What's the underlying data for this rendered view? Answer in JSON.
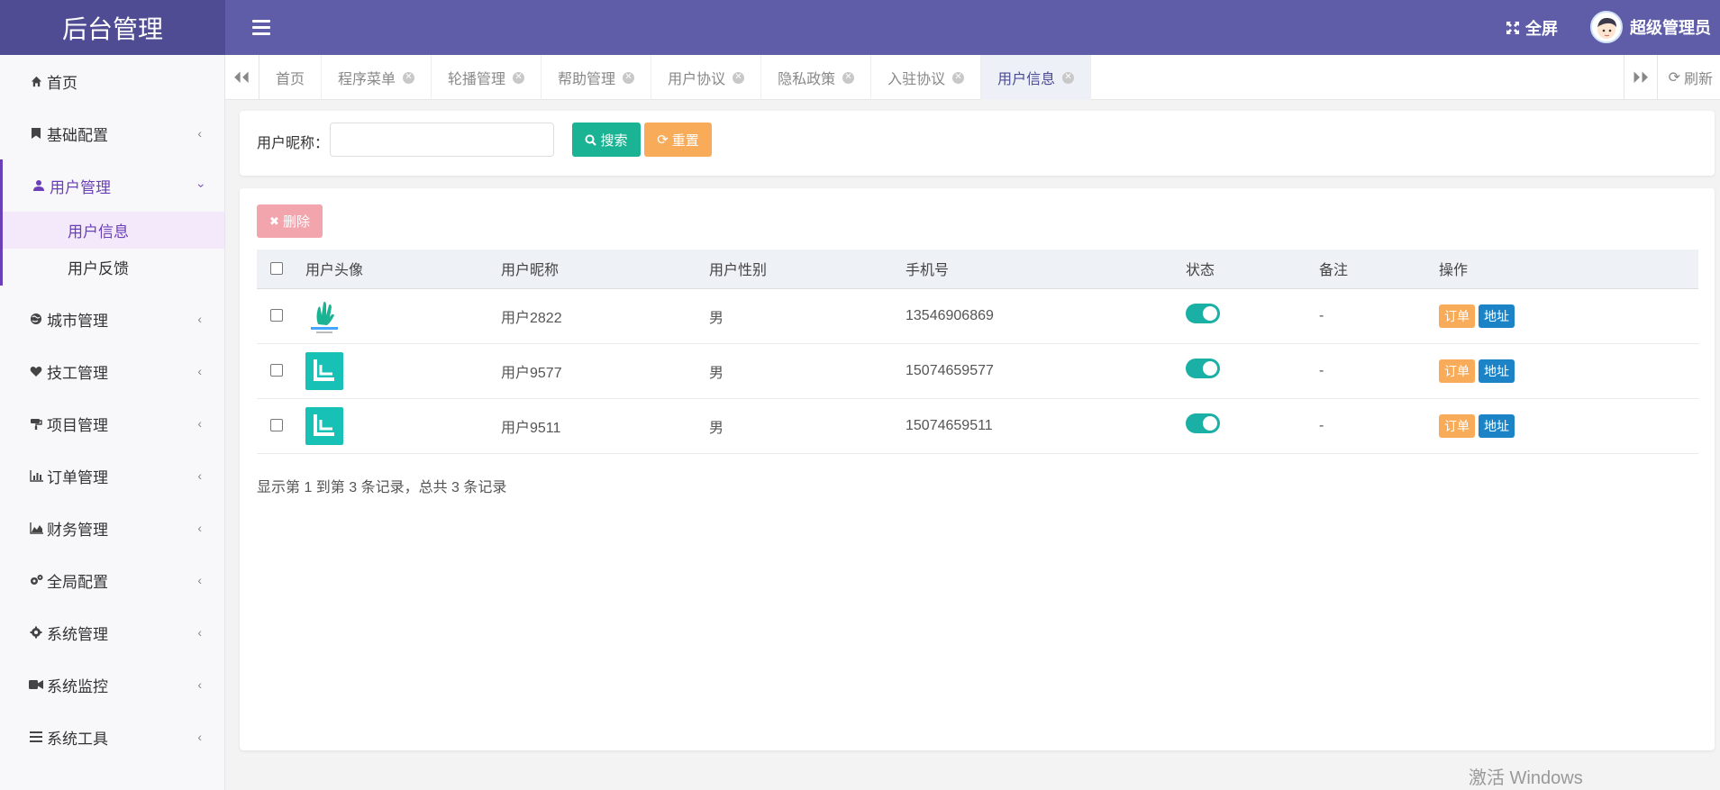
{
  "header": {
    "brand": "后台管理",
    "fullscreen_label": "全屏",
    "username": "超级管理员"
  },
  "sidebar": {
    "items": [
      {
        "label": "首页",
        "icon": "home-icon"
      },
      {
        "label": "基础配置",
        "icon": "bookmark-icon"
      },
      {
        "label": "用户管理",
        "icon": "user-icon",
        "expanded": true,
        "children": [
          {
            "label": "用户信息",
            "active": true
          },
          {
            "label": "用户反馈"
          }
        ]
      },
      {
        "label": "城市管理",
        "icon": "globe-icon"
      },
      {
        "label": "技工管理",
        "icon": "heart-icon"
      },
      {
        "label": "项目管理",
        "icon": "paint-icon"
      },
      {
        "label": "订单管理",
        "icon": "bar-chart-icon"
      },
      {
        "label": "财务管理",
        "icon": "area-chart-icon"
      },
      {
        "label": "全局配置",
        "icon": "cogs-icon"
      },
      {
        "label": "系统管理",
        "icon": "gear-icon"
      },
      {
        "label": "系统监控",
        "icon": "video-icon"
      },
      {
        "label": "系统工具",
        "icon": "bars-icon"
      }
    ]
  },
  "tabs": [
    {
      "label": "首页",
      "closable": false
    },
    {
      "label": "程序菜单",
      "closable": true
    },
    {
      "label": "轮播管理",
      "closable": true
    },
    {
      "label": "帮助管理",
      "closable": true
    },
    {
      "label": "用户协议",
      "closable": true
    },
    {
      "label": "隐私政策",
      "closable": true
    },
    {
      "label": "入驻协议",
      "closable": true
    },
    {
      "label": "用户信息",
      "closable": true,
      "active": true
    }
  ],
  "tabs_refresh": "刷新",
  "search": {
    "label": "用户昵称：",
    "value": "",
    "search_button": "搜索",
    "reset_button": "重置"
  },
  "toolbar": {
    "delete_button": "删除"
  },
  "table": {
    "columns": [
      "用户头像",
      "用户昵称",
      "用户性别",
      "手机号",
      "状态",
      "备注",
      "操作"
    ],
    "rows": [
      {
        "avatar": "hand-logo",
        "nickname": "用户2822",
        "gender": "男",
        "phone": "13546906869",
        "status": true,
        "remark": "-"
      },
      {
        "avatar": "teal-l-logo",
        "nickname": "用户9577",
        "gender": "男",
        "phone": "15074659577",
        "status": true,
        "remark": "-"
      },
      {
        "avatar": "teal-l-logo",
        "nickname": "用户9511",
        "gender": "男",
        "phone": "15074659511",
        "status": true,
        "remark": "-"
      }
    ],
    "actions": {
      "order": "订单",
      "address": "地址"
    }
  },
  "pagination": {
    "summary": "显示第 1 到第 3 条记录，总共 3 条记录"
  },
  "watermark": "激活 Windows",
  "colors": {
    "header": "#5f5ca8",
    "brand_bg": "#4f4c94",
    "accent_purple": "#6b3fb7",
    "search_btn": "#1ab394",
    "reset_btn": "#f8ac59",
    "delete_btn": "#f3a5ae",
    "toggle_on": "#1bb0a5",
    "address_btn": "#1c84c6"
  }
}
